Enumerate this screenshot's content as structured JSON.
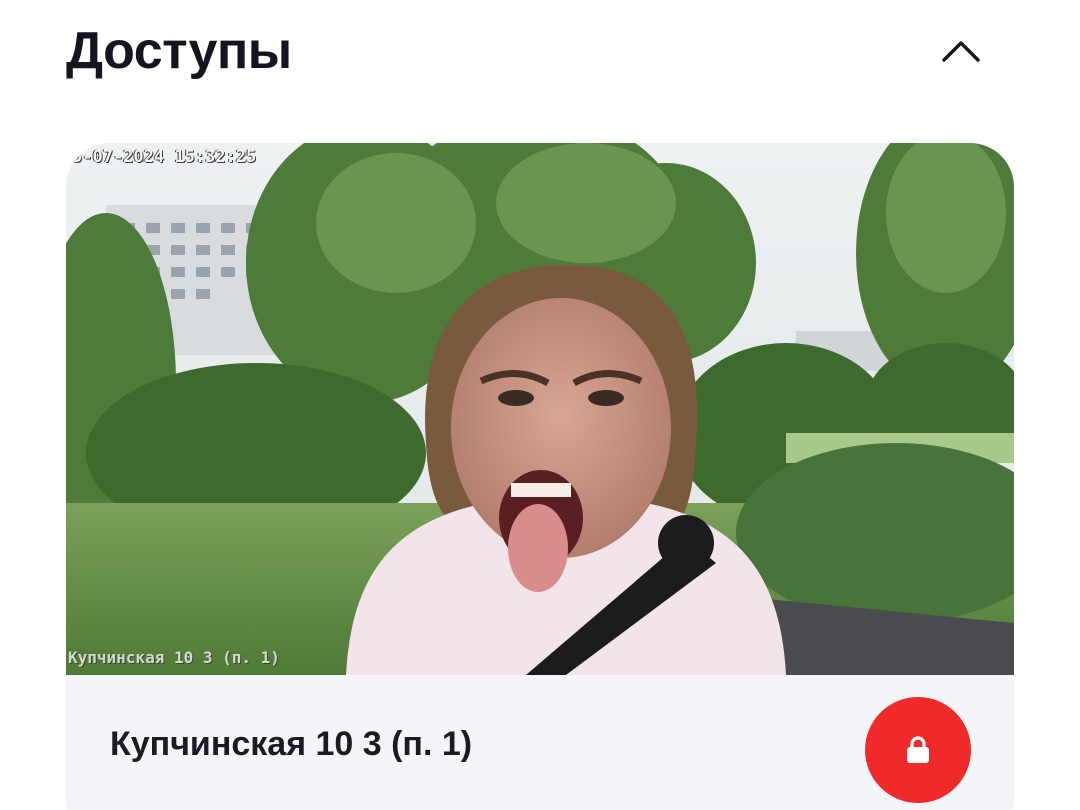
{
  "section": {
    "title": "Доступы",
    "collapse_icon": "chevron-up-icon"
  },
  "card": {
    "camera": {
      "timestamp": "5-07-2024 15:32:25",
      "location_overlay": "Купчинская 10 3 (п. 1)"
    },
    "address": "Купчинская 10 3 (п. 1)",
    "lock_icon": "lock-icon",
    "lock_color": "#f02a2a"
  }
}
